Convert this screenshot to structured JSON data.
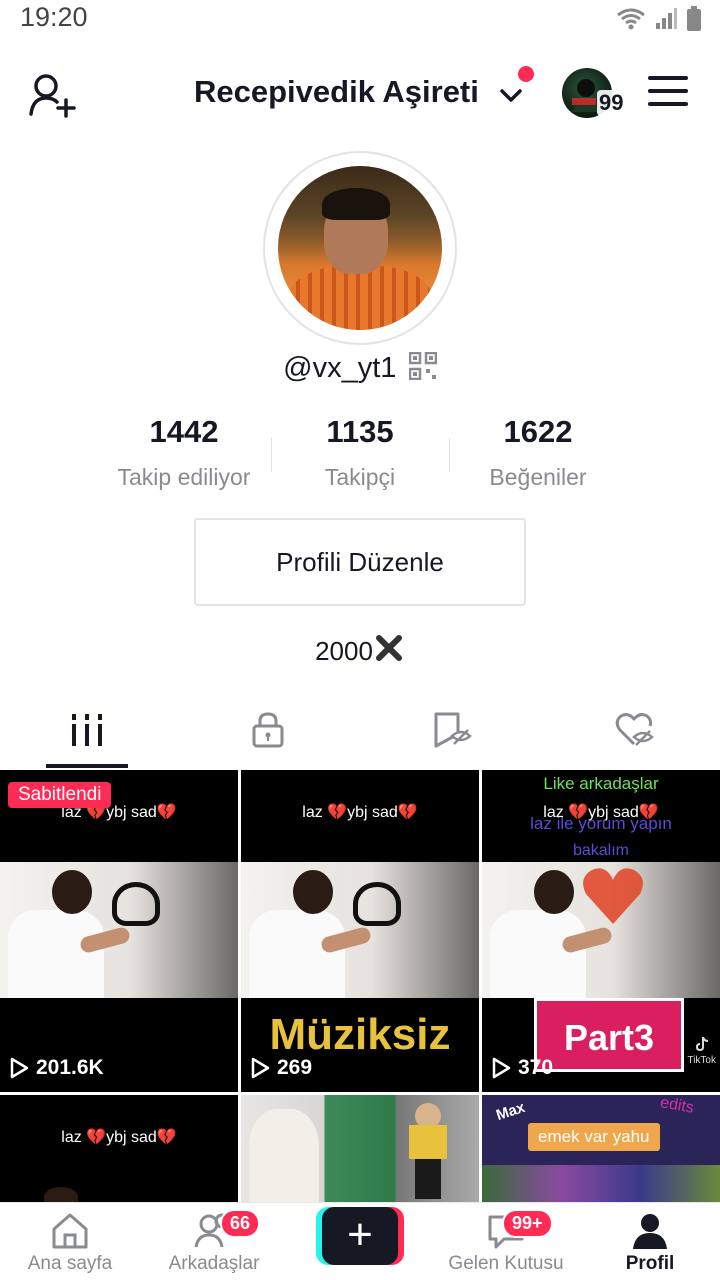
{
  "status_bar": {
    "time": "19:20"
  },
  "header": {
    "account_name": "Recepivedik Aşireti",
    "mini_avatar_count": "99"
  },
  "profile": {
    "username": "@vx_yt1",
    "stats": [
      {
        "value": "1442",
        "label": "Takip ediliyor"
      },
      {
        "value": "1135",
        "label": "Takipçi"
      },
      {
        "value": "1622",
        "label": "Beğeniler"
      }
    ],
    "edit_button": "Profili Düzenle",
    "bio": "2000"
  },
  "grid": {
    "pinned_label": "Sabitlendi",
    "videos": [
      {
        "caption_a": "laz ",
        "caption_b": "ybj sad",
        "plays": "201.6K"
      },
      {
        "caption_a": "laz ",
        "caption_b": "ybj sad",
        "plays": "269",
        "overlay": "Müziksiz"
      },
      {
        "caption_a": "laz ",
        "caption_b": "ybj sad",
        "plays": "370",
        "top_text": "Like arkadaşlar",
        "mid_text": "laz ile yorum yapın",
        "low_text": "bakalım",
        "overlay": "Part3",
        "watermark": "TikTok"
      },
      {
        "caption_a": "laz ",
        "caption_b": "ybj sad"
      },
      {},
      {
        "max": "Max",
        "edits": "edits",
        "banner": "emek var yahu"
      }
    ]
  },
  "bottom_nav": {
    "home": "Ana sayfa",
    "friends": "Arkadaşlar",
    "friends_badge": "66",
    "create": "+",
    "inbox": "Gelen Kutusu",
    "inbox_badge": "99+",
    "profile": "Profil"
  },
  "colors": {
    "accent": "#fe2c55",
    "cyan": "#25f4ee",
    "text": "#161823",
    "muted": "#8a8b91"
  }
}
